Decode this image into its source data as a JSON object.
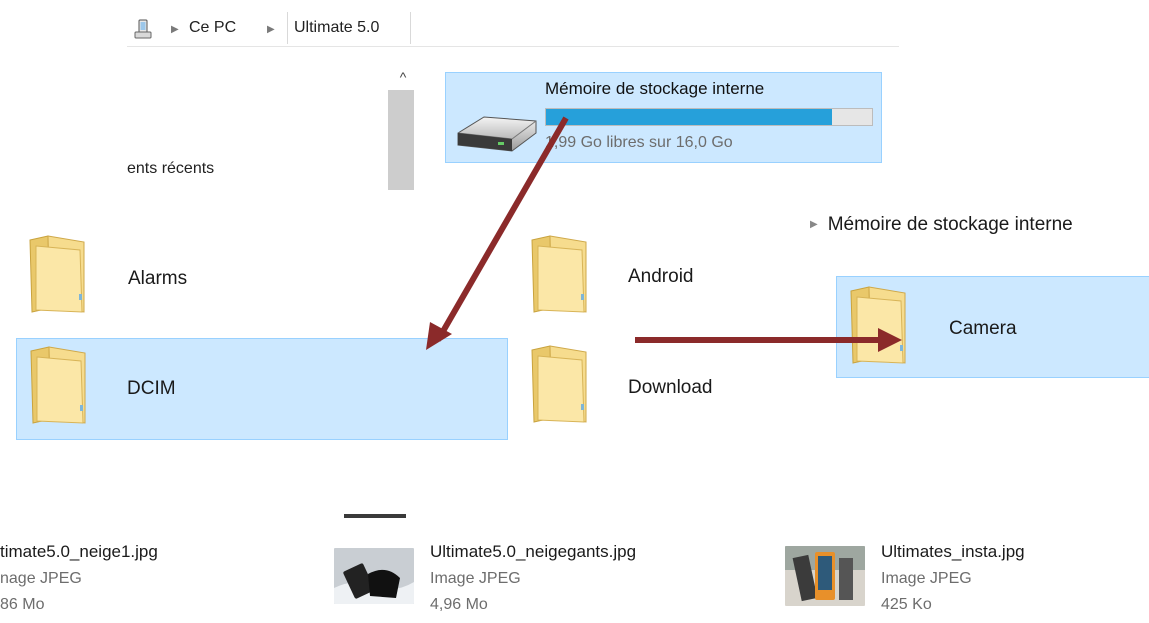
{
  "breadcrumb": {
    "icon": "phone-device-icon",
    "items": [
      "Ce PC",
      "Ultimate 5.0"
    ]
  },
  "sidebar": {
    "recent_label": "ents récents"
  },
  "scroll": {
    "up_glyph": "^"
  },
  "drive": {
    "name": "Mémoire de stockage interne",
    "free_text": "1,99 Go libres sur 16,0 Go",
    "used_fraction": 0.876,
    "bar_color": "#26a0da"
  },
  "folders": [
    {
      "name": "Alarms",
      "selected": false
    },
    {
      "name": "Android",
      "selected": false
    },
    {
      "name": "DCIM",
      "selected": true
    },
    {
      "name": "Download",
      "selected": false
    }
  ],
  "camera_panel": {
    "header": "Mémoire de stockage interne",
    "folder": "Camera"
  },
  "files": [
    {
      "name": "timate5.0_neige1.jpg",
      "type": "nage JPEG",
      "size": "86 Mo"
    },
    {
      "name": "Ultimate5.0_neigegants.jpg",
      "type": "Image JPEG",
      "size": "4,96 Mo"
    },
    {
      "name": "Ultimates_insta.jpg",
      "type": "Image JPEG",
      "size": "425 Ko"
    }
  ],
  "colors": {
    "selection_bg": "#cce8ff",
    "selection_border": "#99d1ff",
    "arrow": "#8b2a2a"
  }
}
